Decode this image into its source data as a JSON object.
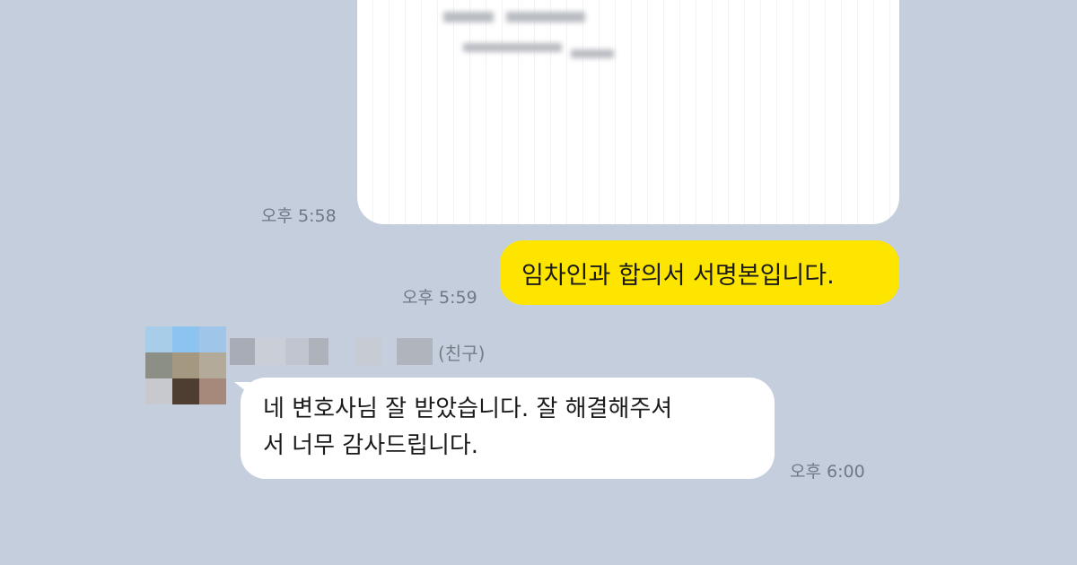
{
  "chat": {
    "messages": [
      {
        "type": "image",
        "sender": "me",
        "time": "오후 5:58"
      },
      {
        "type": "text",
        "sender": "me",
        "text": "임차인과 합의서 서명본입니다.",
        "time": "오후 5:59"
      },
      {
        "type": "text",
        "sender": "friend",
        "name_tag": "(친구)",
        "lines": [
          "네 변호사님 잘 받았습니다. 잘 해결해주셔",
          "서 너무 감사드립니다."
        ],
        "time": "오후 6:00"
      }
    ]
  },
  "colors": {
    "background": "#c5cedd",
    "my_bubble": "#fee500",
    "friend_bubble": "#ffffff",
    "timestamp": "#6f7886"
  },
  "avatar_pixels": [
    "#a8cde8",
    "#8bc4ef",
    "#9fc6e8",
    "#8c8f86",
    "#a59880",
    "#b4aa9a",
    "#c7c9cf",
    "#4e3d31",
    "#a6897b"
  ],
  "name_pixels": [
    "#a8acb6",
    "#c9ced7",
    "#c0c5cf",
    "#aeb2bb",
    "#c6cbd4",
    "#b0b4bd"
  ]
}
